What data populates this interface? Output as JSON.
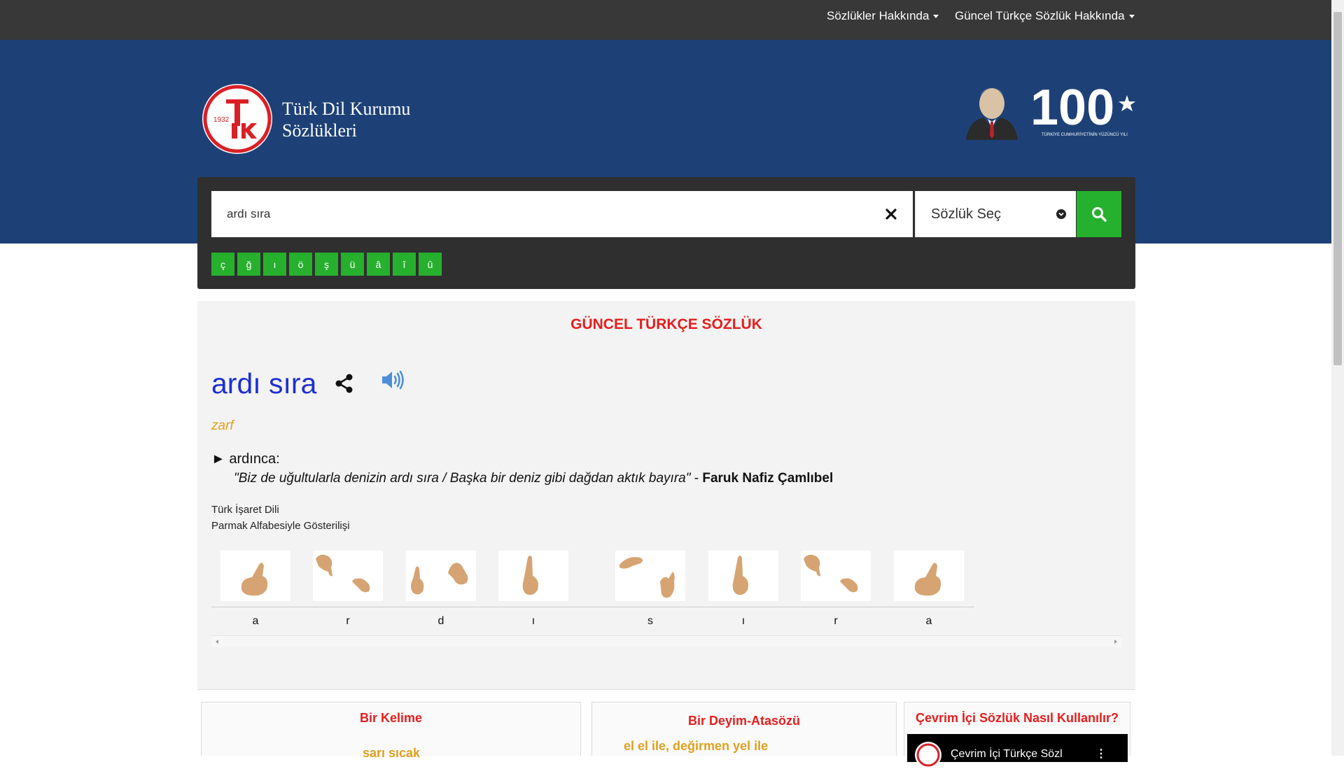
{
  "nav": {
    "menu1": "Sözlükler Hakkında",
    "menu2": "Güncel Türkçe Sözlük Hakkında"
  },
  "header": {
    "logo_year": "1932",
    "org_line1": "Türk Dil Kurumu",
    "org_line2": "Sözlükleri",
    "centennial_number": "100",
    "centennial_caption": "TÜRKİYE CUMHURİYETİNİN YÜZÜNCÜ YILI"
  },
  "search": {
    "value": "ardı sıra",
    "dictionary_select": "Sözlük Seç",
    "special_chars": [
      "ç",
      "ğ",
      "ı",
      "ö",
      "ş",
      "ü",
      "â",
      "î",
      "û"
    ]
  },
  "result": {
    "dictionary_title": "GÜNCEL TÜRKÇE SÖZLÜK",
    "word": "ardı sıra",
    "part_of_speech": "zarf",
    "definition_marker": "►",
    "definition": "ardınca:",
    "example_quote": "\"Biz de uğultularla denizin ardı sıra / Başka bir deniz gibi dağdan aktık bayıra\"",
    "example_separator": " - ",
    "example_author": "Faruk Nafiz Çamlıbel",
    "sign_language_label": "Türk İşaret Dili",
    "fingerspelling_label": "Parmak Alfabesiyle Gösterilişi",
    "fingerspelling_letters": [
      "a",
      "r",
      "d",
      "ı",
      "s",
      "ı",
      "r",
      "a"
    ]
  },
  "cards": {
    "word_card_title": "Bir Kelime",
    "word_card_value": "sarı sıcak",
    "idiom_card_title": "Bir Deyim-Atasözü",
    "idiom_card_value": "el el ile, değirmen yel ile",
    "howto_card_title": "Çevrim İçi Sözlük Nasıl Kullanılır?",
    "video_title": "Çevrim İçi Türkçe Sözl"
  },
  "colors": {
    "topbar": "#383838",
    "header_blue": "#1d4177",
    "accent_green": "#25b12e",
    "title_red": "#e41e1e",
    "word_blue": "#1e2fd2",
    "pos_orange": "#e0a020"
  }
}
